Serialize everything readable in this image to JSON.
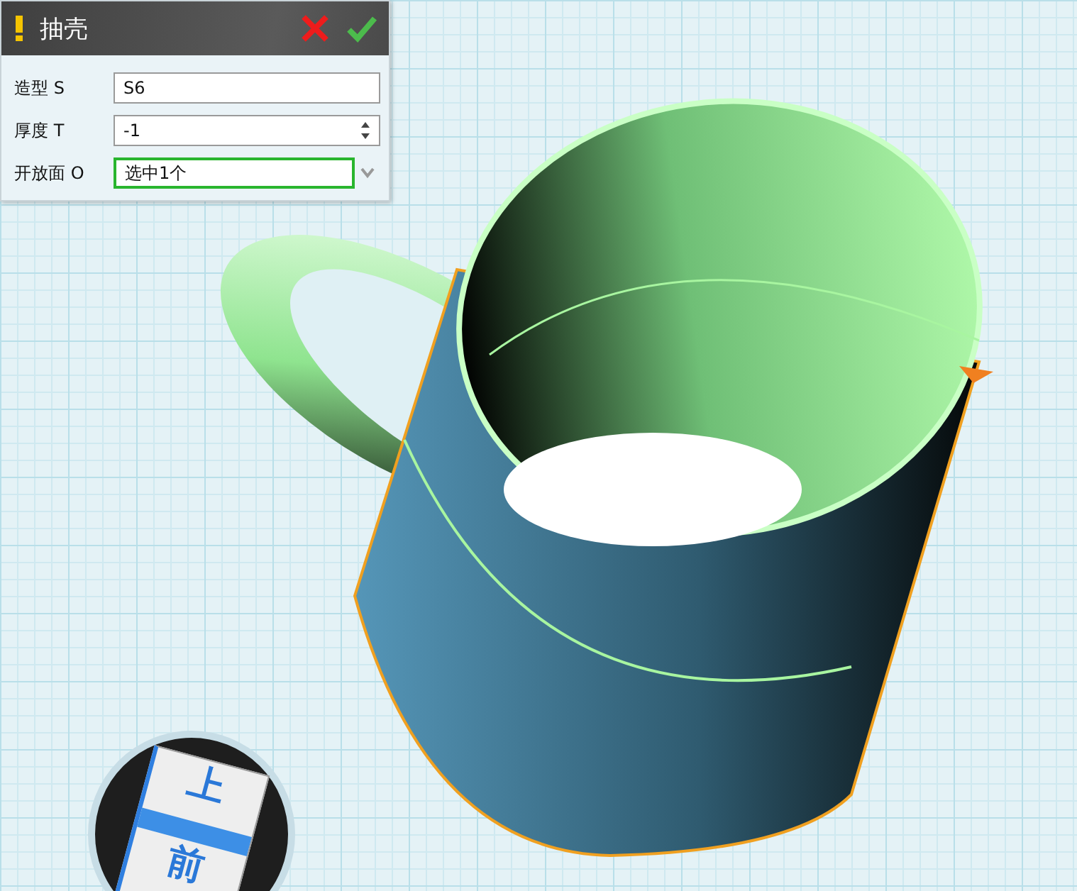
{
  "panel": {
    "title": "抽壳",
    "fields": [
      {
        "label": "造型 S",
        "value": "S6",
        "kind": "text",
        "focused": false
      },
      {
        "label": "厚度 T",
        "value": "-1",
        "kind": "spinner",
        "focused": false
      },
      {
        "label": "开放面 O",
        "value": "选中1个",
        "kind": "dropdown",
        "focused": true
      }
    ]
  },
  "view_cube": {
    "top": "上",
    "front": "前"
  }
}
